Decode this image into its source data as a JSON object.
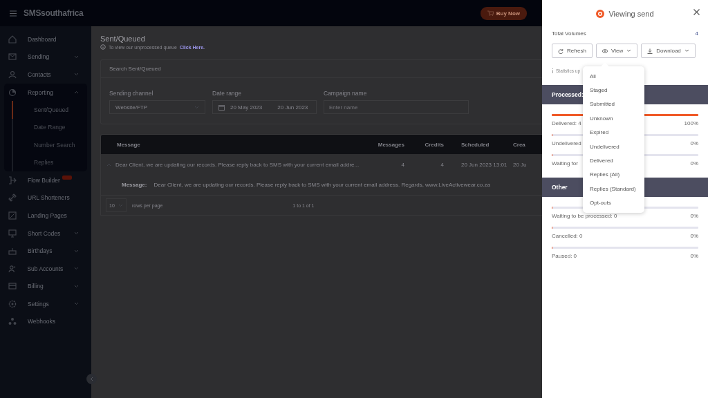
{
  "topbar": {
    "logo": "SMSsouthafrica",
    "buy_button": "Buy Now"
  },
  "sidebar": {
    "items": [
      {
        "label": "Dashboard",
        "kind": "link"
      },
      {
        "label": "Sending",
        "kind": "group",
        "expanded": false
      },
      {
        "label": "Contacts",
        "kind": "group",
        "expanded": false
      },
      {
        "label": "Reporting",
        "kind": "group",
        "expanded": true,
        "children": [
          {
            "label": "Sent/Queued",
            "selected": true
          },
          {
            "label": "Date Range",
            "selected": false
          },
          {
            "label": "Number Search",
            "selected": false
          },
          {
            "label": "Replies",
            "selected": false
          }
        ]
      },
      {
        "label": "Flow Builder",
        "kind": "link",
        "badge": true
      },
      {
        "label": "URL Shorteners",
        "kind": "link"
      },
      {
        "label": "Landing Pages",
        "kind": "link"
      },
      {
        "label": "Short Codes",
        "kind": "group",
        "expanded": false
      },
      {
        "label": "Birthdays",
        "kind": "group",
        "expanded": false
      },
      {
        "label": "Sub Accounts",
        "kind": "group",
        "expanded": false
      },
      {
        "label": "Billing",
        "kind": "group",
        "expanded": false
      },
      {
        "label": "Settings",
        "kind": "group",
        "expanded": false
      },
      {
        "label": "Webhooks",
        "kind": "link"
      }
    ]
  },
  "page": {
    "title": "Sent/Queued",
    "info": "To view our unprocessed queue",
    "info_link": "Click Here.",
    "search": {
      "title": "Search Sent/Queued",
      "fields": [
        {
          "label": "Sending channel",
          "kind": "select",
          "value": "Website/FTP"
        },
        {
          "label": "Date range",
          "kind": "daterange",
          "from": "20 May 2023",
          "to": "20 Jun 2023"
        },
        {
          "label": "Campaign name",
          "kind": "text",
          "placeholder": "Enter name"
        }
      ]
    },
    "table": {
      "columns": [
        "Message",
        "Messages",
        "Credits",
        "Scheduled",
        "Crea"
      ],
      "rows": [
        {
          "expanded": true,
          "cells": [
            "Dear Client, we are updating our records. Please reply back to SMS with your current email addre...",
            "4",
            "4",
            "20 Jun 2023 13:01",
            "20 Ju"
          ],
          "detail_label": "Message:",
          "detail": "Dear Client, we are updating our records. Please reply back to SMS with your current email address. Regards, www.LiveActivewear.co.za"
        }
      ],
      "page_size": "10",
      "page_size_label": "rows per page",
      "pagination": "1 to 1 of 1"
    }
  },
  "drawer": {
    "title": "Viewing send",
    "total_label": "Total Volumes",
    "total": "4",
    "buttons": [
      {
        "label": "Refresh",
        "kind": "refresh"
      },
      {
        "label": "View",
        "kind": "view"
      },
      {
        "label": "Download",
        "kind": "download"
      }
    ],
    "note": "Statistics up",
    "sections": [
      {
        "title": "Processed:",
        "rows": [
          {
            "label": "Delivered: 4",
            "level": 1,
            "reading": "100%"
          },
          {
            "label": "Undelivered",
            "level": 0,
            "reading": "0%"
          },
          {
            "label": "Waiting for",
            "level": 0,
            "reading": "0%"
          }
        ]
      },
      {
        "title": "Other",
        "rows": [
          {
            "label": "Waiting to be processed: 0",
            "level": 0,
            "reading": "0%"
          },
          {
            "label": "Cancelled: 0",
            "level": 0,
            "reading": "0%"
          },
          {
            "label": "Paused: 0",
            "level": 0,
            "reading": "0%"
          }
        ]
      }
    ],
    "menu": [
      "All",
      "Staged",
      "Submitted",
      "Unknown",
      "Expired",
      "Undelivered",
      "Delivered",
      "Replies (All)",
      "Replies (Standard)",
      "Opt-outs"
    ]
  }
}
